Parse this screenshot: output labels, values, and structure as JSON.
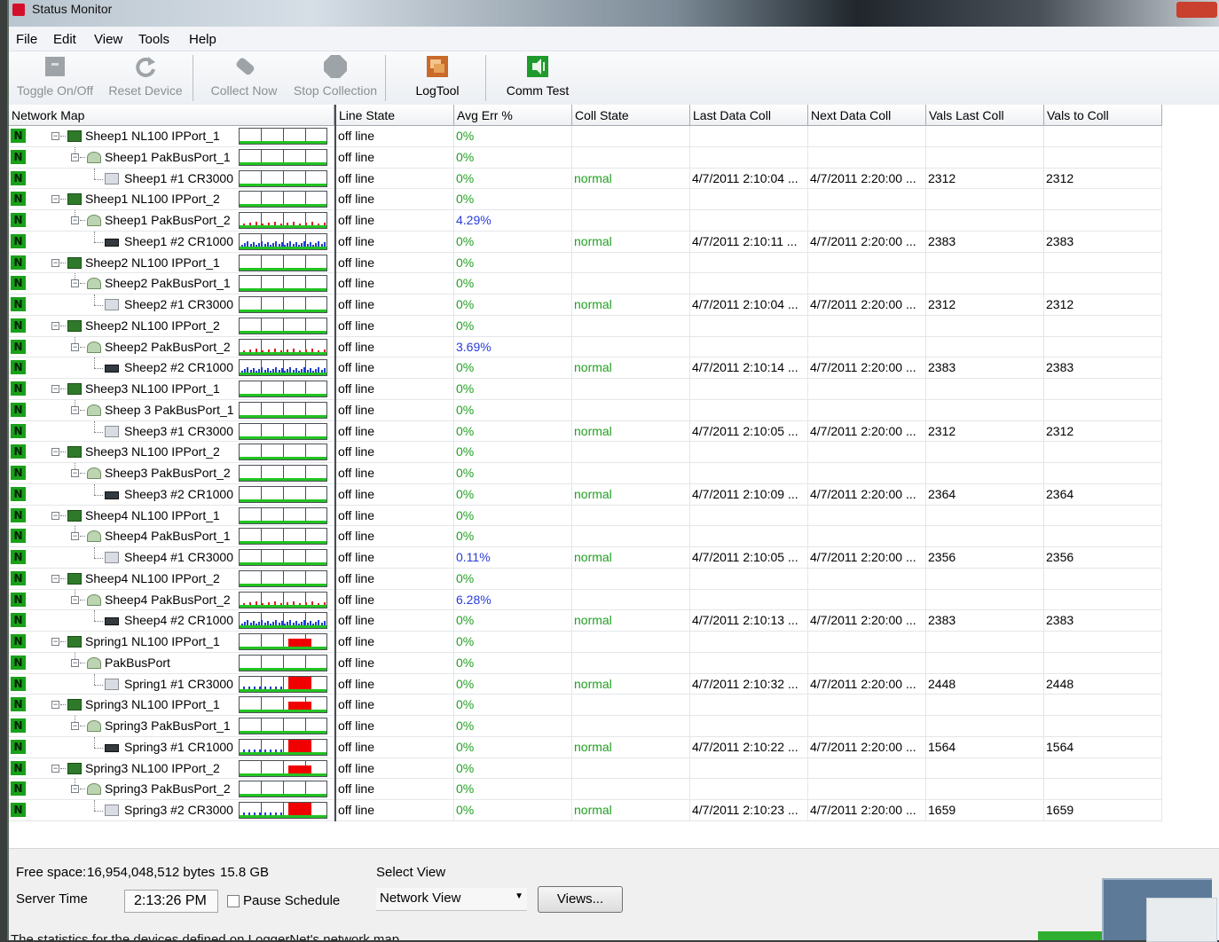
{
  "window": {
    "title": "Status Monitor"
  },
  "menu": [
    "File",
    "Edit",
    "View",
    "Tools",
    "Help"
  ],
  "toolbar": {
    "buttons": [
      {
        "label": "Toggle On/Off",
        "enabled": false,
        "icon": "toggle-icon"
      },
      {
        "label": "Reset Device",
        "enabled": false,
        "icon": "reset-icon"
      },
      {
        "label": "Collect Now",
        "enabled": false,
        "icon": "collect-icon"
      },
      {
        "label": "Stop Collection",
        "enabled": false,
        "icon": "stop-icon"
      },
      {
        "label": "LogTool",
        "enabled": true,
        "icon": "logtool-icon"
      },
      {
        "label": "Comm Test",
        "enabled": true,
        "icon": "comm-test-icon"
      }
    ]
  },
  "table": {
    "headers": [
      "Network Map",
      "Line State",
      "Avg Err %",
      "Coll State",
      "Last Data Coll",
      "Next Data Coll",
      "Vals Last Coll",
      "Vals to Coll"
    ],
    "rows": [
      {
        "level": 1,
        "type": "ipport",
        "name": "Sheep1 NL100 IPPort_1",
        "line_state": "off line",
        "avg_err": "0%",
        "coll_state": "",
        "last_coll": "",
        "next_coll": "",
        "vals_last": "",
        "vals_to": "",
        "spark": "flat"
      },
      {
        "level": 2,
        "type": "pakbus",
        "name": "Sheep1 PakBusPort_1",
        "line_state": "off line",
        "avg_err": "0%",
        "coll_state": "",
        "last_coll": "",
        "next_coll": "",
        "vals_last": "",
        "vals_to": "",
        "spark": "flat"
      },
      {
        "level": 3,
        "type": "cr3000",
        "name": "Sheep1 #1 CR3000",
        "line_state": "off line",
        "avg_err": "0%",
        "coll_state": "normal",
        "last_coll": "4/7/2011 2:10:04 ...",
        "next_coll": "4/7/2011 2:20:00 ...",
        "vals_last": "2312",
        "vals_to": "2312",
        "spark": "flat"
      },
      {
        "level": 1,
        "type": "ipport",
        "name": "Sheep1 NL100 IPPort_2",
        "line_state": "off line",
        "avg_err": "0%",
        "coll_state": "",
        "last_coll": "",
        "next_coll": "",
        "vals_last": "",
        "vals_to": "",
        "spark": "flat"
      },
      {
        "level": 2,
        "type": "pakbus",
        "name": "Sheep1 PakBusPort_2",
        "line_state": "off line",
        "avg_err": "4.29%",
        "coll_state": "",
        "last_coll": "",
        "next_coll": "",
        "vals_last": "",
        "vals_to": "",
        "spark": "red-ticks"
      },
      {
        "level": 3,
        "type": "cr1000",
        "name": "Sheep1 #2 CR1000",
        "line_state": "off line",
        "avg_err": "0%",
        "coll_state": "normal",
        "last_coll": "4/7/2011 2:10:11 ...",
        "next_coll": "4/7/2011 2:20:00 ...",
        "vals_last": "2383",
        "vals_to": "2383",
        "spark": "blue-ticks"
      },
      {
        "level": 1,
        "type": "ipport",
        "name": "Sheep2 NL100 IPPort_1",
        "line_state": "off line",
        "avg_err": "0%",
        "coll_state": "",
        "last_coll": "",
        "next_coll": "",
        "vals_last": "",
        "vals_to": "",
        "spark": "flat"
      },
      {
        "level": 2,
        "type": "pakbus",
        "name": "Sheep2 PakBusPort_1",
        "line_state": "off line",
        "avg_err": "0%",
        "coll_state": "",
        "last_coll": "",
        "next_coll": "",
        "vals_last": "",
        "vals_to": "",
        "spark": "flat"
      },
      {
        "level": 3,
        "type": "cr3000",
        "name": "Sheep2 #1 CR3000",
        "line_state": "off line",
        "avg_err": "0%",
        "coll_state": "normal",
        "last_coll": "4/7/2011 2:10:04 ...",
        "next_coll": "4/7/2011 2:20:00 ...",
        "vals_last": "2312",
        "vals_to": "2312",
        "spark": "flat"
      },
      {
        "level": 1,
        "type": "ipport",
        "name": "Sheep2 NL100 IPPort_2",
        "line_state": "off line",
        "avg_err": "0%",
        "coll_state": "",
        "last_coll": "",
        "next_coll": "",
        "vals_last": "",
        "vals_to": "",
        "spark": "flat"
      },
      {
        "level": 2,
        "type": "pakbus",
        "name": "Sheep2 PakBusPort_2",
        "line_state": "off line",
        "avg_err": "3.69%",
        "coll_state": "",
        "last_coll": "",
        "next_coll": "",
        "vals_last": "",
        "vals_to": "",
        "spark": "red-ticks"
      },
      {
        "level": 3,
        "type": "cr1000",
        "name": "Sheep2 #2 CR1000",
        "line_state": "off line",
        "avg_err": "0%",
        "coll_state": "normal",
        "last_coll": "4/7/2011 2:10:14 ...",
        "next_coll": "4/7/2011 2:20:00 ...",
        "vals_last": "2383",
        "vals_to": "2383",
        "spark": "blue-ticks"
      },
      {
        "level": 1,
        "type": "ipport",
        "name": "Sheep3 NL100 IPPort_1",
        "line_state": "off line",
        "avg_err": "0%",
        "coll_state": "",
        "last_coll": "",
        "next_coll": "",
        "vals_last": "",
        "vals_to": "",
        "spark": "flat"
      },
      {
        "level": 2,
        "type": "pakbus",
        "name": "Sheep 3 PakBusPort_1",
        "line_state": "off line",
        "avg_err": "0%",
        "coll_state": "",
        "last_coll": "",
        "next_coll": "",
        "vals_last": "",
        "vals_to": "",
        "spark": "flat"
      },
      {
        "level": 3,
        "type": "cr3000",
        "name": "Sheep3 #1 CR3000",
        "line_state": "off line",
        "avg_err": "0%",
        "coll_state": "normal",
        "last_coll": "4/7/2011 2:10:05 ...",
        "next_coll": "4/7/2011 2:20:00 ...",
        "vals_last": "2312",
        "vals_to": "2312",
        "spark": "flat"
      },
      {
        "level": 1,
        "type": "ipport",
        "name": "Sheep3 NL100 IPPort_2",
        "line_state": "off line",
        "avg_err": "0%",
        "coll_state": "",
        "last_coll": "",
        "next_coll": "",
        "vals_last": "",
        "vals_to": "",
        "spark": "flat"
      },
      {
        "level": 2,
        "type": "pakbus",
        "name": "Sheep3 PakBusPort_2",
        "line_state": "off line",
        "avg_err": "0%",
        "coll_state": "",
        "last_coll": "",
        "next_coll": "",
        "vals_last": "",
        "vals_to": "",
        "spark": "flat"
      },
      {
        "level": 3,
        "type": "cr1000",
        "name": "Sheep3 #2 CR1000",
        "line_state": "off line",
        "avg_err": "0%",
        "coll_state": "normal",
        "last_coll": "4/7/2011 2:10:09 ...",
        "next_coll": "4/7/2011 2:20:00 ...",
        "vals_last": "2364",
        "vals_to": "2364",
        "spark": "flat"
      },
      {
        "level": 1,
        "type": "ipport",
        "name": "Sheep4 NL100 IPPort_1",
        "line_state": "off line",
        "avg_err": "0%",
        "coll_state": "",
        "last_coll": "",
        "next_coll": "",
        "vals_last": "",
        "vals_to": "",
        "spark": "flat"
      },
      {
        "level": 2,
        "type": "pakbus",
        "name": "Sheep4 PakBusPort_1",
        "line_state": "off line",
        "avg_err": "0%",
        "coll_state": "",
        "last_coll": "",
        "next_coll": "",
        "vals_last": "",
        "vals_to": "",
        "spark": "flat"
      },
      {
        "level": 3,
        "type": "cr3000",
        "name": "Sheep4 #1 CR3000",
        "line_state": "off line",
        "avg_err": "0.11%",
        "coll_state": "normal",
        "last_coll": "4/7/2011 2:10:05 ...",
        "next_coll": "4/7/2011 2:20:00 ...",
        "vals_last": "2356",
        "vals_to": "2356",
        "spark": "flat"
      },
      {
        "level": 1,
        "type": "ipport",
        "name": "Sheep4 NL100 IPPort_2",
        "line_state": "off line",
        "avg_err": "0%",
        "coll_state": "",
        "last_coll": "",
        "next_coll": "",
        "vals_last": "",
        "vals_to": "",
        "spark": "flat"
      },
      {
        "level": 2,
        "type": "pakbus",
        "name": "Sheep4 PakBusPort_2",
        "line_state": "off line",
        "avg_err": "6.28%",
        "coll_state": "",
        "last_coll": "",
        "next_coll": "",
        "vals_last": "",
        "vals_to": "",
        "spark": "red-ticks"
      },
      {
        "level": 3,
        "type": "cr1000",
        "name": "Sheep4 #2 CR1000",
        "line_state": "off line",
        "avg_err": "0%",
        "coll_state": "normal",
        "last_coll": "4/7/2011 2:10:13 ...",
        "next_coll": "4/7/2011 2:20:00 ...",
        "vals_last": "2383",
        "vals_to": "2383",
        "spark": "blue-ticks"
      },
      {
        "level": 1,
        "type": "ipport",
        "name": "Spring1 NL100 IPPort_1",
        "line_state": "off line",
        "avg_err": "0%",
        "coll_state": "",
        "last_coll": "",
        "next_coll": "",
        "vals_last": "",
        "vals_to": "",
        "spark": "red-block-small"
      },
      {
        "level": 2,
        "type": "pakbus",
        "name": "PakBusPort",
        "line_state": "off line",
        "avg_err": "0%",
        "coll_state": "",
        "last_coll": "",
        "next_coll": "",
        "vals_last": "",
        "vals_to": "",
        "spark": "flat"
      },
      {
        "level": 3,
        "type": "cr3000",
        "name": "Spring1 #1 CR3000",
        "line_state": "off line",
        "avg_err": "0%",
        "coll_state": "normal",
        "last_coll": "4/7/2011 2:10:32 ...",
        "next_coll": "4/7/2011 2:20:00 ...",
        "vals_last": "2448",
        "vals_to": "2448",
        "spark": "red-block-large"
      },
      {
        "level": 1,
        "type": "ipport",
        "name": "Spring3 NL100 IPPort_1",
        "line_state": "off line",
        "avg_err": "0%",
        "coll_state": "",
        "last_coll": "",
        "next_coll": "",
        "vals_last": "",
        "vals_to": "",
        "spark": "red-block-small"
      },
      {
        "level": 2,
        "type": "pakbus",
        "name": "Spring3 PakBusPort_1",
        "line_state": "off line",
        "avg_err": "0%",
        "coll_state": "",
        "last_coll": "",
        "next_coll": "",
        "vals_last": "",
        "vals_to": "",
        "spark": "flat"
      },
      {
        "level": 3,
        "type": "cr1000",
        "name": "Spring3 #1 CR1000",
        "line_state": "off line",
        "avg_err": "0%",
        "coll_state": "normal",
        "last_coll": "4/7/2011 2:10:22 ...",
        "next_coll": "4/7/2011 2:20:00 ...",
        "vals_last": "1564",
        "vals_to": "1564",
        "spark": "red-block-large"
      },
      {
        "level": 1,
        "type": "ipport",
        "name": "Spring3 NL100 IPPort_2",
        "line_state": "off line",
        "avg_err": "0%",
        "coll_state": "",
        "last_coll": "",
        "next_coll": "",
        "vals_last": "",
        "vals_to": "",
        "spark": "red-block-small"
      },
      {
        "level": 2,
        "type": "pakbus",
        "name": "Spring3 PakBusPort_2",
        "line_state": "off line",
        "avg_err": "0%",
        "coll_state": "",
        "last_coll": "",
        "next_coll": "",
        "vals_last": "",
        "vals_to": "",
        "spark": "flat"
      },
      {
        "level": 3,
        "type": "cr3000",
        "name": "Spring3 #2 CR3000",
        "line_state": "off line",
        "avg_err": "0%",
        "coll_state": "normal",
        "last_coll": "4/7/2011 2:10:23 ...",
        "next_coll": "4/7/2011 2:20:00 ...",
        "vals_last": "1659",
        "vals_to": "1659",
        "spark": "red-block-large"
      }
    ]
  },
  "bottom": {
    "free_space_label": "Free space:",
    "free_space_bytes": "16,954,048,512 bytes",
    "free_space_gb": "15.8 GB",
    "server_time_label": "Server Time",
    "server_time": "2:13:26 PM",
    "pause_schedule_label": "Pause Schedule",
    "pause_schedule_checked": false,
    "select_view_label": "Select View",
    "select_view_value": "Network View",
    "views_button": "Views...",
    "status_text": "The statistics for the devices defined on LoggerNet's network map"
  },
  "colors": {
    "ok_green": "#22a022",
    "err_blue": "#2a3cd8",
    "node_badge": "#19a019",
    "alarm_red": "#f00000"
  }
}
